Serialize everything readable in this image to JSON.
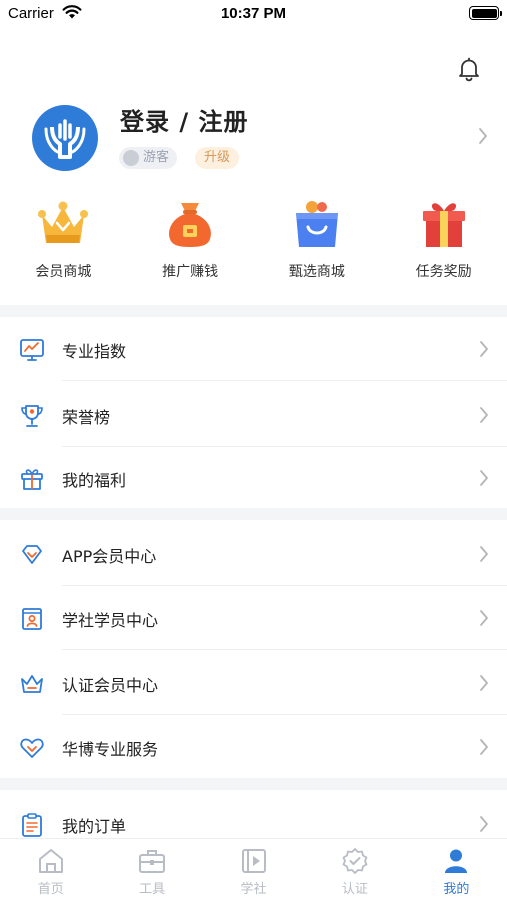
{
  "status_bar": {
    "carrier": "Carrier",
    "time": "10:37 PM"
  },
  "profile": {
    "title": "登录 / 注册",
    "guest_badge": "游客",
    "upgrade_badge": "升级"
  },
  "quick_actions": [
    {
      "label": "会员商城",
      "icon": "crown-icon"
    },
    {
      "label": "推广赚钱",
      "icon": "money-bag-icon"
    },
    {
      "label": "甄选商城",
      "icon": "shopping-bag-icon"
    },
    {
      "label": "任务奖励",
      "icon": "gift-box-icon"
    }
  ],
  "menu": {
    "group1": [
      {
        "label": "专业指数",
        "icon": "chart-monitor-icon"
      },
      {
        "label": "荣誉榜",
        "icon": "trophy-icon"
      },
      {
        "label": "我的福利",
        "icon": "gift-icon"
      }
    ],
    "group2": [
      {
        "label": "APP会员中心",
        "icon": "diamond-icon"
      },
      {
        "label": "学社学员中心",
        "icon": "student-card-icon"
      },
      {
        "label": "认证会员中心",
        "icon": "crown-outline-icon"
      },
      {
        "label": "华博专业服务",
        "icon": "heart-icon"
      }
    ],
    "group3": [
      {
        "label": "我的订单",
        "icon": "clipboard-icon"
      }
    ]
  },
  "tabbar": [
    {
      "label": "首页",
      "icon": "home-icon",
      "active": false
    },
    {
      "label": "工具",
      "icon": "toolbox-icon",
      "active": false
    },
    {
      "label": "学社",
      "icon": "video-icon",
      "active": false
    },
    {
      "label": "认证",
      "icon": "certificate-icon",
      "active": false
    },
    {
      "label": "我的",
      "icon": "user-icon",
      "active": true
    }
  ],
  "colors": {
    "accent": "#2f7bd8",
    "inactive": "#b8bcc4",
    "background_band": "#f4f5f7"
  }
}
